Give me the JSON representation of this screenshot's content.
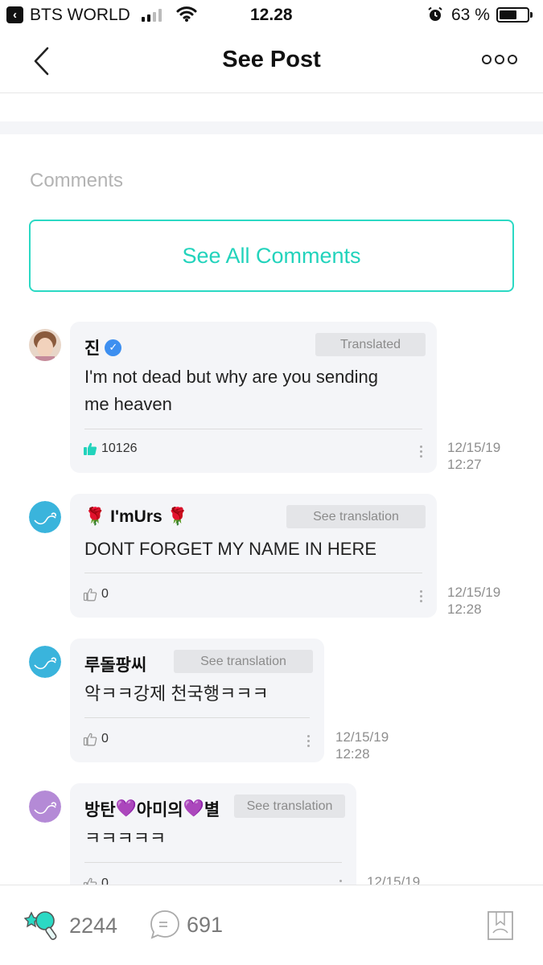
{
  "status_bar": {
    "back_app": "BTS WORLD",
    "time": "12.28",
    "battery_pct": "63 %",
    "battery_level": 0.63
  },
  "header": {
    "title": "See Post"
  },
  "comments_section": {
    "label": "Comments",
    "see_all": "See All Comments"
  },
  "comments": [
    {
      "name": "진",
      "verified": true,
      "translation_label": "Translated",
      "text_lines": [
        "I'm not dead but why are you sending",
        "me heaven"
      ],
      "likes": "10126",
      "liked": true,
      "date": "12/15/19",
      "time": "12:27",
      "avatar": "profile-photo"
    },
    {
      "name_prefix": "🌹",
      "name": "I'mUrs",
      "name_suffix": "🌹",
      "translation_label": "See translation",
      "text_lines": [
        "DONT FORGET MY NAME IN HERE"
      ],
      "likes": "0",
      "liked": false,
      "date": "12/15/19",
      "time": "12:28",
      "avatar": "default-blue"
    },
    {
      "name": "루돌팡씨",
      "translation_label": "See translation",
      "text_lines": [
        "악ㅋㅋ강제 천국행ㅋㅋㅋ"
      ],
      "likes": "0",
      "liked": false,
      "date": "12/15/19",
      "time": "12:28",
      "avatar": "default-blue"
    },
    {
      "name_parts": [
        "방탄",
        "💜",
        "아미의",
        "💜",
        "별"
      ],
      "translation_label": "See translation",
      "text_lines": [
        "ㅋㅋㅋㅋㅋ"
      ],
      "likes": "0",
      "liked": false,
      "date": "12/15/19",
      "avatar": "default-purple"
    }
  ],
  "bottom_bar": {
    "likes": "2244",
    "comments": "691"
  },
  "colors": {
    "accent": "#22d3bc",
    "bubble_bg": "#f4f5f8",
    "verified_blue": "#3d8ff0",
    "date_gray": "#8e8e8e"
  }
}
